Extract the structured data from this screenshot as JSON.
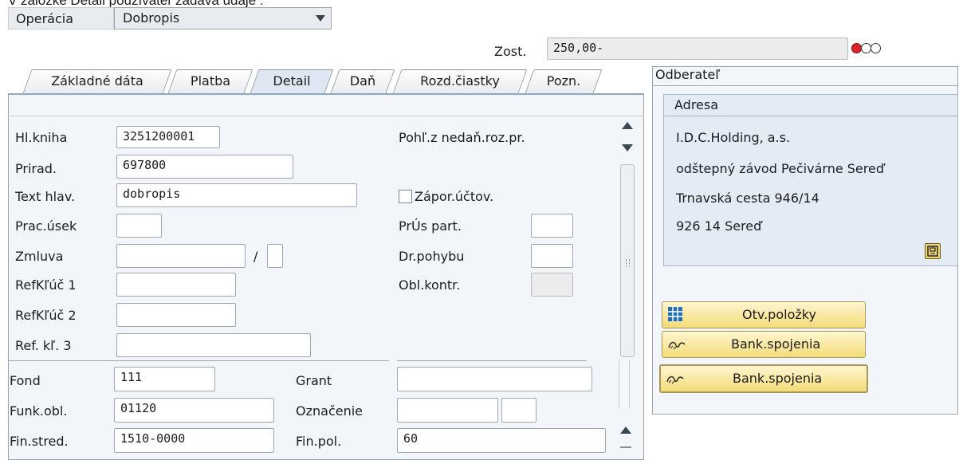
{
  "header": {
    "caption": "V záložke Detail používateľ zadáva údaje :",
    "operation_label": "Operácia",
    "operation_value": "Dobropis"
  },
  "balance": {
    "label": "Zost.",
    "value": "250,00-"
  },
  "tabs": [
    {
      "label": "Základné dáta",
      "active": false
    },
    {
      "label": "Platba",
      "active": false
    },
    {
      "label": "Detail",
      "active": true
    },
    {
      "label": "Daň",
      "active": false
    },
    {
      "label": "Rozd.čiastky",
      "active": false
    },
    {
      "label": "Pozn.",
      "active": false
    }
  ],
  "form": {
    "hl_kniha": {
      "label": "Hl.kniha",
      "value": "3251200001"
    },
    "prirad": {
      "label": "Prirad.",
      "value": "697800"
    },
    "text_hlav": {
      "label": "Text hlav.",
      "value": "dobropis"
    },
    "prac_usek": {
      "label": "Prac.úsek",
      "value": ""
    },
    "zmluva": {
      "label": "Zmluva",
      "value": "",
      "separator": "/"
    },
    "refkluc1": {
      "label": "RefKľúč 1",
      "value": ""
    },
    "refkluc2": {
      "label": "RefKľúč 2",
      "value": ""
    },
    "refkl3": {
      "label": "Ref. kľ. 3",
      "value": ""
    },
    "pohl_nedan": {
      "label": "Pohľ.z nedaň.roz.pr."
    },
    "zapor_uctov": {
      "label": "Zápor.účtov.",
      "checked": false
    },
    "prus_part": {
      "label": "PrÚs part.",
      "value": ""
    },
    "dr_pohybu": {
      "label": "Dr.pohybu",
      "value": ""
    },
    "obl_kontr": {
      "label": "Obl.kontr.",
      "value": ""
    }
  },
  "funds": {
    "fond": {
      "label": "Fond",
      "value": "111"
    },
    "funk_obl": {
      "label": "Funk.obl.",
      "value": "01120"
    },
    "fin_stred": {
      "label": "Fin.stred.",
      "value": "1510-0000"
    },
    "grant": {
      "label": "Grant",
      "value": ""
    },
    "oznacenie": {
      "label": "Označenie",
      "value": ""
    },
    "fin_pol": {
      "label": "Fin.pol.",
      "value": "60"
    }
  },
  "customer": {
    "title": "Odberateľ",
    "address_title": "Adresa",
    "lines": [
      "I.D.C.Holding, a.s.",
      "odštepný závod Pečivárne Sereď",
      "Trnavská cesta 946/14",
      "926 14 Sereď"
    ]
  },
  "buttons": {
    "open_items": "Otv.položky",
    "bank1": "Bank.spojenia",
    "bank2": "Bank.spojenia"
  },
  "colors": {
    "panel_bg": "#f2f6fa",
    "tab_active": "#dfe8f2",
    "button_yellow": "#f3dc79",
    "status_red": "#e0222a"
  }
}
